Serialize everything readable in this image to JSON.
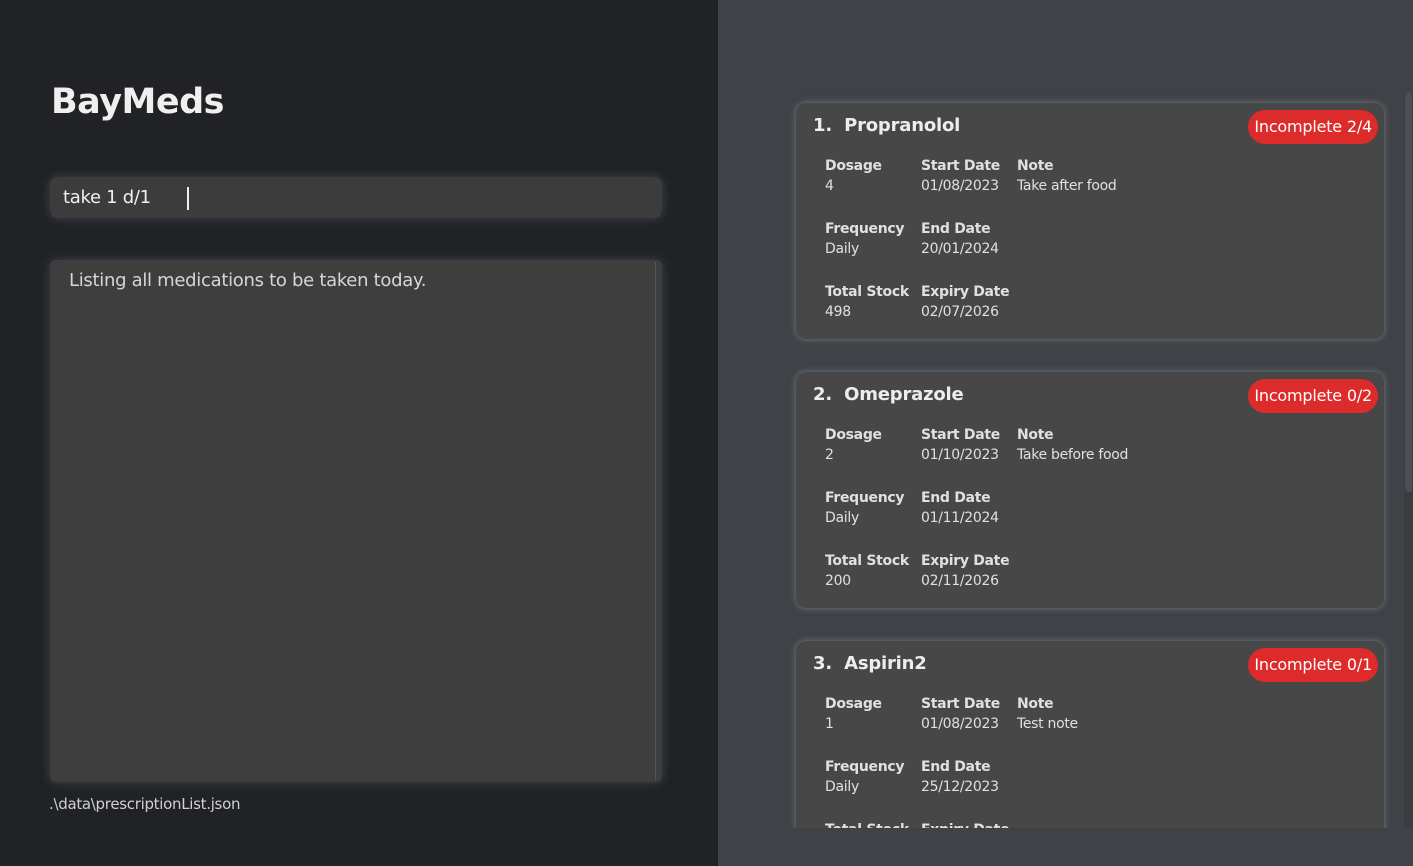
{
  "app": {
    "title": "BayMeds"
  },
  "command": {
    "value": "take 1 d/1"
  },
  "result": {
    "text": "Listing all medications to be taken today."
  },
  "status": {
    "file_path": ".\\data\\prescriptionList.json"
  },
  "labels": {
    "dosage": "Dosage",
    "start_date": "Start Date",
    "note": "Note",
    "frequency": "Frequency",
    "end_date": "End Date",
    "total_stock": "Total Stock",
    "expiry_date": "Expiry Date"
  },
  "medications": [
    {
      "title": "1.  Propranolol",
      "status": "Incomplete 2/4",
      "dosage": "4",
      "start_date": "01/08/2023",
      "note": "Take after food",
      "frequency": "Daily",
      "end_date": "20/01/2024",
      "total_stock": "498",
      "expiry_date": "02/07/2026"
    },
    {
      "title": "2.  Omeprazole",
      "status": "Incomplete 0/2",
      "dosage": "2",
      "start_date": "01/10/2023",
      "note": "Take before food",
      "frequency": "Daily",
      "end_date": "01/11/2024",
      "total_stock": "200",
      "expiry_date": "02/11/2026"
    },
    {
      "title": "3.  Aspirin2",
      "status": "Incomplete 0/1",
      "dosage": "1",
      "start_date": "01/08/2023",
      "note": "Test note",
      "frequency": "Daily",
      "end_date": "25/12/2023",
      "total_stock": "",
      "expiry_date": ""
    }
  ],
  "colors": {
    "left_bg": "#202226",
    "right_bg": "#3f4246",
    "card_bg": "#474747",
    "badge_red": "#dd2b2b"
  }
}
